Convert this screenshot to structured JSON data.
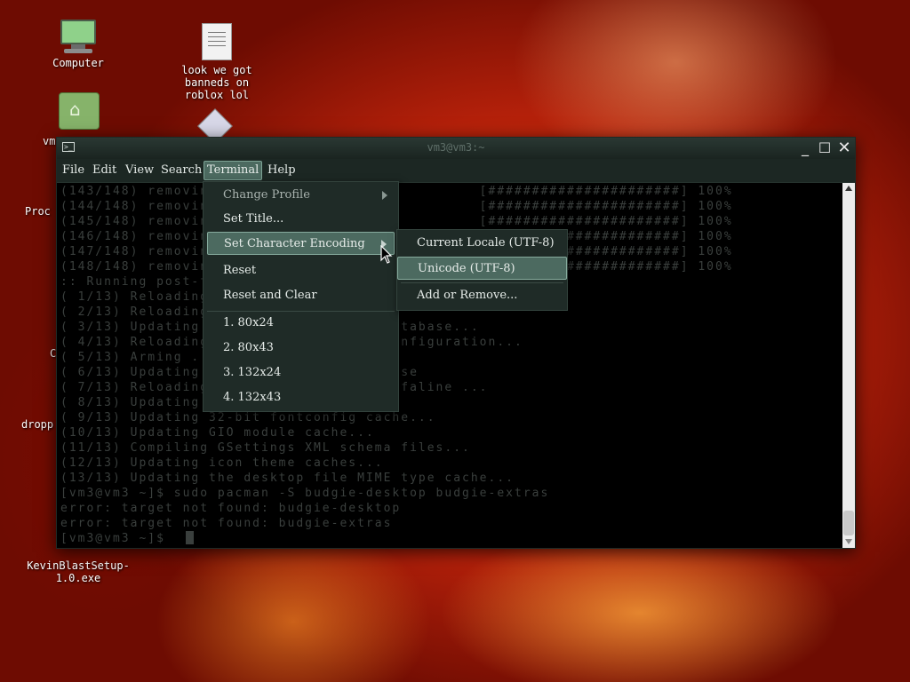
{
  "desktop": {
    "icons": [
      {
        "label": "Computer"
      },
      {
        "label": "look we got\nbanneds on\nroblox lol"
      },
      {
        "label": "KevinBlastSetup-\n1.0.exe"
      }
    ],
    "partial_labels": [
      "vm",
      "Proc",
      "C",
      "dropp"
    ]
  },
  "window": {
    "title": "vm3@vm3:~",
    "menubar": [
      "File",
      "Edit",
      "View",
      "Search",
      "Terminal",
      "Help"
    ],
    "active_menu": "Terminal"
  },
  "terminal": {
    "lines": [
      "(143/148) removing ...                          [######################] 100%",
      "(144/148) removing ...                          [######################] 100%",
      "(145/148) removing ...                          [######################] 100%",
      "(146/148) removing ...                          [######################] 100%",
      "(147/148) removing ...                          [######################] 100%",
      "(148/148) removing ...                          [######################] 100%",
      ":: Running post-transaction hooks...",
      "( 1/13) Reloading ...",
      "( 2/13) Reloading ...",
      "( 3/13) Updating ...                 database...",
      "( 4/13) Reloading ...                configuration...",
      "( 5/13) Arming ...",
      "( 6/13) Updating ...                 base",
      "( 7/13) Reloading ...                 dfaline ...",
      "( 8/13) Updating ...",
      "( 9/13) Updating 32-bit fontconfig cache...",
      "(10/13) Updating GIO module cache...",
      "(11/13) Compiling GSettings XML schema files...",
      "(12/13) Updating icon theme caches...",
      "(13/13) Updating the desktop file MIME type cache...",
      "[vm3@vm3 ~]$ sudo pacman -S budgie-desktop budgie-extras",
      "error: target not found: budgie-desktop",
      "error: target not found: budgie-extras",
      "[vm3@vm3 ~]$ "
    ]
  },
  "terminal_menu": {
    "items": [
      {
        "label": "Change Profile",
        "submenu": true
      },
      {
        "label": "Set Title...",
        "submenu": false
      },
      {
        "label": "Set Character Encoding",
        "submenu": true
      },
      {
        "label": "Reset",
        "submenu": false
      },
      {
        "label": "Reset and Clear",
        "submenu": false
      },
      {
        "label": "1. 80x24",
        "submenu": false
      },
      {
        "label": "2. 80x43",
        "submenu": false
      },
      {
        "label": "3. 132x24",
        "submenu": false
      },
      {
        "label": "4. 132x43",
        "submenu": false
      }
    ]
  },
  "encoding_submenu": {
    "items": [
      {
        "label": "Current Locale (UTF-8)"
      },
      {
        "label": "Unicode (UTF-8)"
      },
      {
        "label": "Add or Remove..."
      }
    ]
  },
  "colors": {
    "menu_bg": "#1f2b27",
    "menu_highlight": "#4c6a60",
    "terminal_text": "#3a3f3d"
  }
}
